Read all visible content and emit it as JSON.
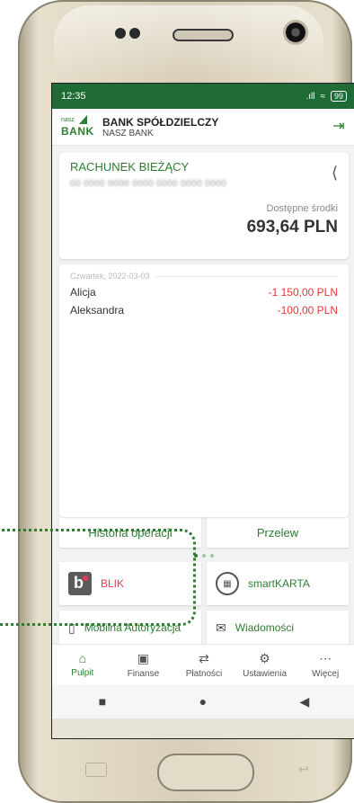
{
  "status": {
    "time": "12:35",
    "signal": ".ıll",
    "wifi": "≈",
    "battery": "99"
  },
  "header": {
    "logo_small": "nasz",
    "logo_big": "BANK",
    "bank_name": "BANK SPÓŁDZIELCZY",
    "bank_sub": "NASZ BANK"
  },
  "account": {
    "name": "RACHUNEK BIEŻĄCY",
    "number": "00 0000 0000 0000 0000 0000 0000",
    "available_label": "Dostępne środki",
    "balance": "693,64 PLN"
  },
  "transactions": {
    "date": "Czwartek, 2022-03-03",
    "items": [
      {
        "name": "Alicja",
        "amount": "-1 150,00 PLN"
      },
      {
        "name": "Aleksandra",
        "amount": "-100,00 PLN"
      }
    ]
  },
  "actions": {
    "history": "Historia operacji",
    "transfer": "Przelew"
  },
  "tiles": {
    "blik": "BLIK",
    "smartkarta": "smartKARTA",
    "auth": "Mobilna Autoryzacja",
    "messages": "Wiadomości"
  },
  "nav": [
    {
      "label": "Pulpit",
      "icon": "home-icon"
    },
    {
      "label": "Finanse",
      "icon": "wallet-icon"
    },
    {
      "label": "Płatności",
      "icon": "transfer-arrows-icon"
    },
    {
      "label": "Ustawienia",
      "icon": "gear-icon"
    },
    {
      "label": "Więcej",
      "icon": "more-dots-icon"
    }
  ],
  "colors": {
    "brand_green": "#2e7d32",
    "status_green": "#1f6b36",
    "negative_red": "#e53935",
    "blik_pink": "#e53958"
  }
}
